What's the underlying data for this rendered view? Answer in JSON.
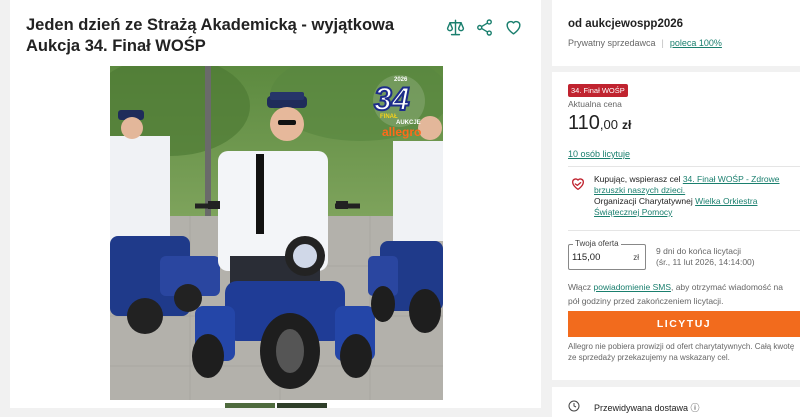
{
  "listing": {
    "title": "Jeden dzień ze Strażą Akademicką - wyjątkowa Aukcja 34. Finał WOŚP"
  },
  "seller": {
    "name": "od aukcjewospp2026",
    "type": "Prywatny sprzedawca",
    "separator": "|",
    "recommendation": "poleca 100%"
  },
  "auction": {
    "badge": "34. Finał WOŚP",
    "current_price_label": "Aktualna cena",
    "price_whole": "110",
    "price_decimal": ",00",
    "price_currency": "zł",
    "bidders_link": "10 osób licytuje"
  },
  "charity": {
    "text_1": "Kupując, wspierasz cel ",
    "cause_link": "34. Finał WOŚP - Zdrowe brzuszki naszych dzieci.",
    "text_2": "Organizacji Charytatywnej ",
    "org_link": "Wielka Orkiestra Świątecznej Pomocy"
  },
  "offer": {
    "label": "Twoja oferta",
    "value": "115,00",
    "currency": "zł",
    "time_left": "9 dni do końca licytacji",
    "end_date": "(śr., 11 lut 2026, 14:14:00)"
  },
  "sms": {
    "text_1": "Włącz ",
    "link": "powiadomienie SMS",
    "text_2": ", aby otrzymać wiadomość na pół godziny przed zakończeniem licytacji."
  },
  "bid_button": "LICYTUJ",
  "fee_note": "Allegro nie pobiera prowizji od ofert charytatywnych. Całą kwotę ze sprzedaży przekazujemy na wskazany cel.",
  "delivery": {
    "label": "Przewidywana dostawa ⓘ"
  },
  "photo_overlay": {
    "number": "34",
    "tag_1": "FINAŁ",
    "tag_2": "AUKCJE",
    "brand": "allegro",
    "year": "2026"
  },
  "icons": {
    "compare": "scales-icon",
    "share": "share-icon",
    "favorite": "heart-icon",
    "charity": "heart-hand-icon",
    "delivery": "clock-icon"
  },
  "colors": {
    "accent": "#1a7f6e",
    "price": "#222222",
    "badge": "#c0232f",
    "button": "#f26b1d"
  }
}
